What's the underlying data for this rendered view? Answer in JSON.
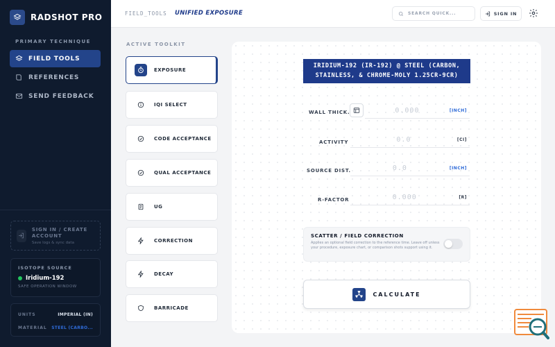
{
  "app": {
    "name": "RADSHOT PRO"
  },
  "sidebar": {
    "section_label": "PRIMARY TECHNIQUE",
    "items": [
      {
        "label": "FIELD TOOLS",
        "icon": "layers-icon",
        "active": true
      },
      {
        "label": "REFERENCES",
        "icon": "book-icon",
        "active": false
      },
      {
        "label": "SEND FEEDBACK",
        "icon": "mail-icon",
        "active": false
      }
    ],
    "signin_card": {
      "title": "SIGN IN / CREATE ACCOUNT",
      "subtitle": "Save logs & sync data"
    },
    "isotope": {
      "label": "ISOTOPE SOURCE",
      "name": "Iridium-192",
      "status": "SAFE OPERATION WINDOW",
      "status_color": "#22c55e"
    },
    "settings": {
      "units_label": "UNITS",
      "units_value": "IMPERIAL (IN)",
      "material_label": "MATERIAL",
      "material_value": "STEEL (CARBO..."
    }
  },
  "header": {
    "crumb_parent": "FIELD_TOOLS",
    "crumb_current": "UNIFIED EXPOSURE",
    "search_placeholder": "SEARCH QUICK...",
    "signin_label": "SIGN IN"
  },
  "toolkit": {
    "label": "ACTIVE TOOLKIT",
    "tools": [
      {
        "label": "EXPOSURE",
        "icon": "timer-icon",
        "active": true
      },
      {
        "label": "IQI SELECT",
        "icon": "info-icon",
        "active": false
      },
      {
        "label": "CODE ACCEPTANCE",
        "icon": "check-circle-icon",
        "active": false
      },
      {
        "label": "QUAL ACCEPTANCE",
        "icon": "check-circle-icon",
        "active": false
      },
      {
        "label": "UG",
        "icon": "document-icon",
        "active": false
      },
      {
        "label": "CORRECTION",
        "icon": "bolt-icon",
        "active": false
      },
      {
        "label": "DECAY",
        "icon": "bolt-icon",
        "active": false
      },
      {
        "label": "BARRICADE",
        "icon": "shield-icon",
        "active": false
      }
    ]
  },
  "exposure": {
    "title_line1": "IRIDIUM-192 (IR-192) @ STEEL (CARBON,",
    "title_line2": "STAINLESS, & CHROME-MOLY 1.25CR-9CR)",
    "fields": [
      {
        "label": "WALL THICK.",
        "value": "0.000",
        "unit": "[INCH]",
        "unit_link": true
      },
      {
        "label": "ACTIVITY",
        "value": "0.0",
        "unit": "[CI]",
        "unit_link": false
      },
      {
        "label": "SOURCE DIST.",
        "value": "0.0",
        "unit": "[INCH]",
        "unit_link": true
      },
      {
        "label": "R-FACTOR",
        "value": "0.000",
        "unit": "[R]",
        "unit_link": false
      }
    ],
    "scatter": {
      "title": "SCATTER / FIELD CORRECTION",
      "description": "Applies an optional field correction to the reference time. Leave off unless your procedure, exposure chart, or comparison shots support using it.",
      "enabled": false
    },
    "calculate_label": "CALCULATE"
  },
  "colors": {
    "sidebar_bg": "#0f1b2e",
    "accent": "#23448a",
    "title_bg": "#1e3a8a",
    "link": "#2f6bd8"
  }
}
